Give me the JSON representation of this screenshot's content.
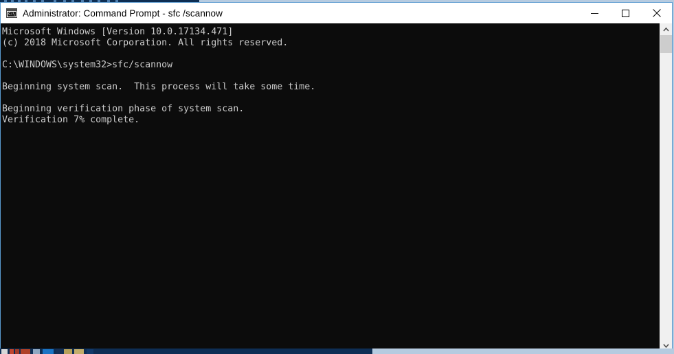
{
  "window": {
    "title": "Administrator: Command Prompt - sfc /scannow",
    "icon": "console-icon",
    "icon_prompt_text": "C:\\_",
    "titlebar_bg": "#ffffff",
    "border_color": "#5a9ad0",
    "controls": {
      "minimize_label": "Minimize",
      "maximize_label": "Maximize",
      "close_label": "Close"
    }
  },
  "console": {
    "background": "#0c0c0c",
    "foreground": "#cccccc",
    "lines": [
      "Microsoft Windows [Version 10.0.17134.471]",
      "(c) 2018 Microsoft Corporation. All rights reserved.",
      "",
      "C:\\WINDOWS\\system32>sfc/scannow",
      "",
      "Beginning system scan.  This process will take some time.",
      "",
      "Beginning verification phase of system scan.",
      "Verification 7% complete."
    ],
    "prompt_path": "C:\\WINDOWS\\system32",
    "command": "sfc/scannow",
    "progress_percent": "7%",
    "status_line": "Verification 7% complete."
  },
  "scrollbar": {
    "up_arrow": "chevron-up-icon",
    "down_arrow": "chevron-down-icon",
    "thumb_color": "#cdcdcd",
    "track_color": "#f0f0f0"
  },
  "desktop": {
    "background": "#b6cbe0",
    "taskbar_color": "#0e2e55",
    "background_window_title_strip_color": "#0d2d52"
  }
}
